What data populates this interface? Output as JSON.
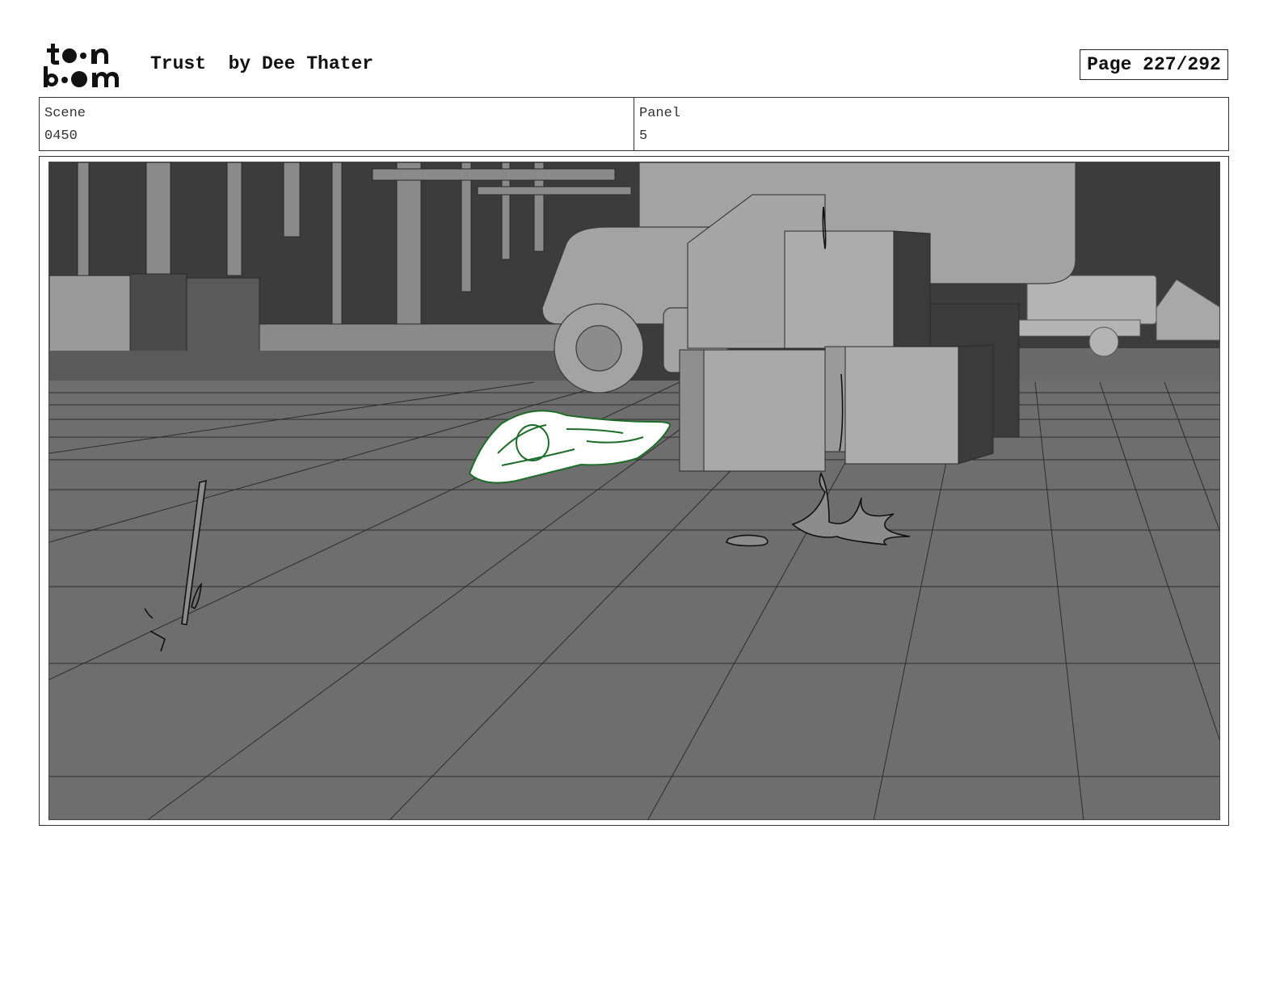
{
  "header": {
    "logo_alt": "toon boom",
    "title": "Trust  by Dee Thater",
    "page_label": "Page 227/292"
  },
  "info": {
    "scene_label": "Scene",
    "scene_value": "0450",
    "panel_label": "Panel",
    "panel_value": "5"
  },
  "colors": {
    "sketch_green": "#1f6b2a",
    "floor": "#6e6e6e",
    "sky": "#3c3c3c"
  }
}
